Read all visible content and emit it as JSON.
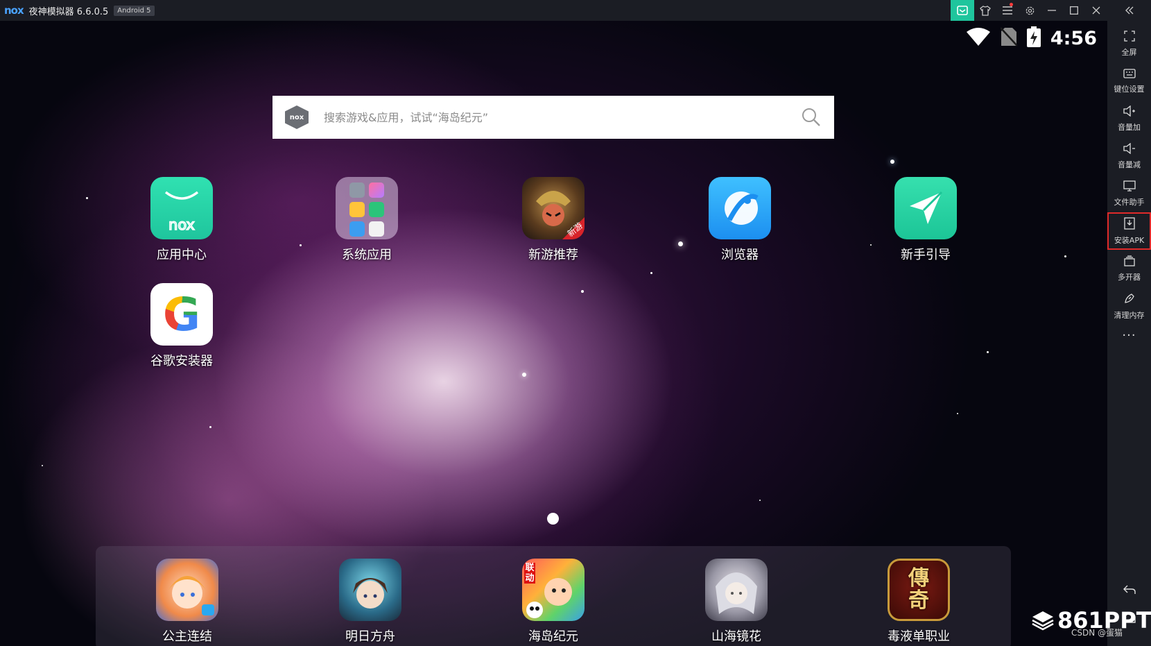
{
  "titlebar": {
    "logo": "nox",
    "title": "夜神模拟器 6.6.0.5",
    "android_badge": "Android 5"
  },
  "statusbar": {
    "time": "4:56"
  },
  "search": {
    "logo": "nox",
    "placeholder": "搜索游戏&应用，试试“海岛纪元”"
  },
  "desktop_apps": [
    {
      "label": "应用中心",
      "icon": "nox-app-center-icon"
    },
    {
      "label": "系统应用",
      "icon": "system-apps-folder-icon"
    },
    {
      "label": "新游推荐",
      "icon": "new-games-icon",
      "badge": "新游"
    },
    {
      "label": "浏览器",
      "icon": "browser-icon"
    },
    {
      "label": "新手引导",
      "icon": "guide-icon"
    },
    {
      "label": "谷歌安装器",
      "icon": "google-installer-icon",
      "glyph": "G"
    }
  ],
  "dock_apps": [
    {
      "label": "公主连结",
      "icon": "princess-connect-icon"
    },
    {
      "label": "明日方舟",
      "icon": "arknights-icon"
    },
    {
      "label": "海岛纪元",
      "icon": "island-era-icon",
      "badge": "联动"
    },
    {
      "label": "山海镜花",
      "icon": "shanhai-jinghua-icon"
    },
    {
      "label": "毒液单职业",
      "icon": "venom-single-class-icon",
      "glyph": "傳奇"
    }
  ],
  "sidebar": {
    "items": [
      {
        "label": "全屏",
        "icon": "fullscreen-icon"
      },
      {
        "label": "键位设置",
        "icon": "keyboard-icon"
      },
      {
        "label": "音量加",
        "icon": "volume-up-icon"
      },
      {
        "label": "音量减",
        "icon": "volume-down-icon"
      },
      {
        "label": "文件助手",
        "icon": "file-assistant-icon"
      },
      {
        "label": "安装APK",
        "icon": "install-apk-icon",
        "selected": true
      },
      {
        "label": "多开器",
        "icon": "multi-instance-icon"
      },
      {
        "label": "清理内存",
        "icon": "clean-memory-icon"
      }
    ],
    "more": "···"
  },
  "watermark": {
    "brand": "861PPT",
    "credit": "CSDN @蛋猫"
  },
  "colors": {
    "titlebar_bg": "#1b1d24",
    "accent_green": "#1fc59d",
    "selected_border": "#e02a2a"
  }
}
